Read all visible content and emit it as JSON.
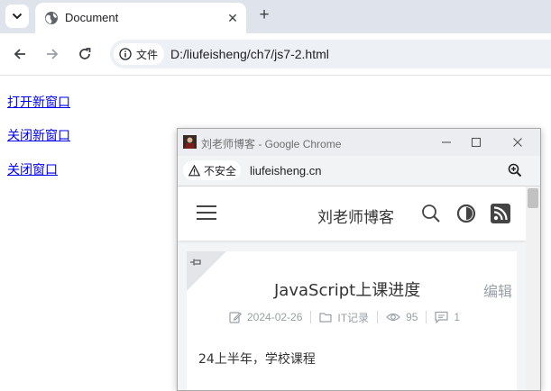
{
  "browser": {
    "tab": {
      "title": "Document",
      "close_glyph": "✕",
      "favicon": "globe-icon"
    },
    "new_tab_glyph": "+",
    "icons": [
      "tab-search-icon",
      "back-arrow-icon",
      "forward-arrow-icon",
      "reload-icon",
      "info-icon"
    ],
    "address_bar": {
      "security_label": "文件",
      "url": "D:/liufeisheng/ch7/js7-2.html"
    }
  },
  "page": {
    "links": [
      {
        "label": "打开新窗口"
      },
      {
        "label": "关闭新窗口"
      },
      {
        "label": "关闭窗口"
      }
    ],
    "link_color": "#0000ee"
  },
  "popup": {
    "title": "刘老师博客 - Google Chrome",
    "window_controls": [
      "minimize-icon",
      "maximize-icon",
      "close-icon"
    ],
    "address_bar": {
      "security_label": "不安全",
      "url": "liufeisheng.cn",
      "zoom_icon": "zoom-icon"
    },
    "site": {
      "title": "刘老师博客",
      "header_icons": [
        "menu-icon",
        "search-icon",
        "theme-toggle-icon",
        "rss-icon"
      ],
      "rss_color": "#444444",
      "post": {
        "pin_icon": "pin-icon",
        "title": "JavaScript上课进度",
        "edit_label": "编辑",
        "meta": {
          "date": "2024-02-26",
          "category": "IT记录",
          "views": "95",
          "comments": "1"
        },
        "excerpt": "24上半年，学校课程"
      }
    }
  }
}
